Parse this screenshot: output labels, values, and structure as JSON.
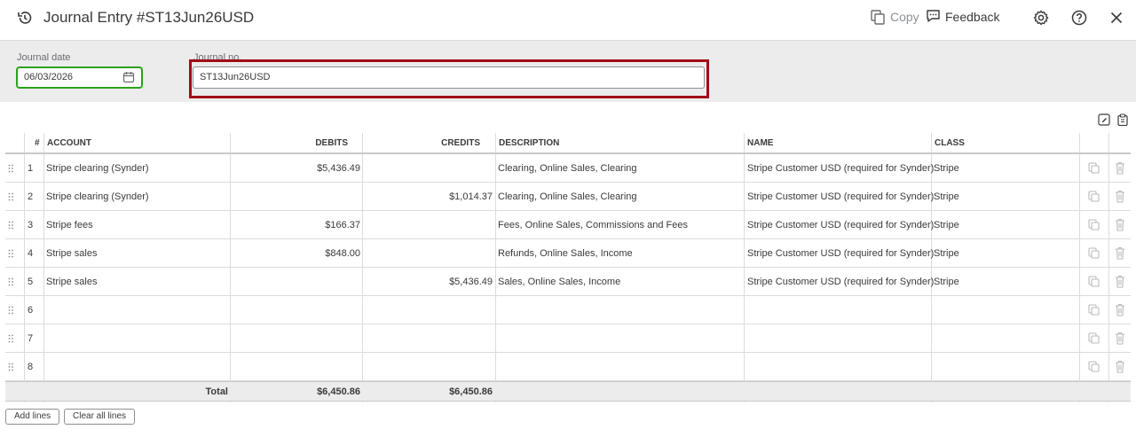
{
  "header": {
    "title": "Journal Entry #ST13Jun26USD",
    "copy_label": "Copy",
    "feedback_label": "Feedback"
  },
  "form": {
    "journal_date_label": "Journal date",
    "journal_date_value": "06/03/2026",
    "journal_no_label": "Journal no.",
    "journal_no_value": "ST13Jun26USD"
  },
  "table": {
    "columns": [
      "#",
      "ACCOUNT",
      "DEBITS",
      "CREDITS",
      "DESCRIPTION",
      "NAME",
      "CLASS"
    ],
    "rows": [
      {
        "n": "1",
        "account": "Stripe clearing (Synder)",
        "debit": "$5,436.49",
        "credit": "",
        "description": "Clearing, Online Sales, Clearing",
        "name": "Stripe Customer USD (required for Synder)",
        "class": "Stripe"
      },
      {
        "n": "2",
        "account": "Stripe clearing (Synder)",
        "debit": "",
        "credit": "$1,014.37",
        "description": "Clearing, Online Sales, Clearing",
        "name": "Stripe Customer USD (required for Synder)",
        "class": "Stripe"
      },
      {
        "n": "3",
        "account": "Stripe fees",
        "debit": "$166.37",
        "credit": "",
        "description": "Fees, Online Sales, Commissions and Fees",
        "name": "Stripe Customer USD (required for Synder)",
        "class": "Stripe"
      },
      {
        "n": "4",
        "account": "Stripe sales",
        "debit": "$848.00",
        "credit": "",
        "description": "Refunds, Online Sales, Income",
        "name": "Stripe Customer USD (required for Synder)",
        "class": "Stripe"
      },
      {
        "n": "5",
        "account": "Stripe sales",
        "debit": "",
        "credit": "$5,436.49",
        "description": "Sales, Online Sales, Income",
        "name": "Stripe Customer USD (required for Synder)",
        "class": "Stripe"
      },
      {
        "n": "6",
        "account": "",
        "debit": "",
        "credit": "",
        "description": "",
        "name": "",
        "class": ""
      },
      {
        "n": "7",
        "account": "",
        "debit": "",
        "credit": "",
        "description": "",
        "name": "",
        "class": ""
      },
      {
        "n": "8",
        "account": "",
        "debit": "",
        "credit": "",
        "description": "",
        "name": "",
        "class": ""
      }
    ],
    "total_label": "Total",
    "total_debits": "$6,450.86",
    "total_credits": "$6,450.86"
  },
  "buttons": {
    "add_lines": "Add lines",
    "clear_all_lines": "Clear all lines"
  },
  "icons": [
    "history-icon",
    "copy-icon",
    "feedback-icon",
    "gear-icon",
    "help-icon",
    "close-icon",
    "calendar-icon",
    "drag-handle-icon",
    "duplicate-icon",
    "trash-icon"
  ],
  "colors": {
    "accent_green": "#2ca01c",
    "highlight_red": "#a10d17"
  }
}
